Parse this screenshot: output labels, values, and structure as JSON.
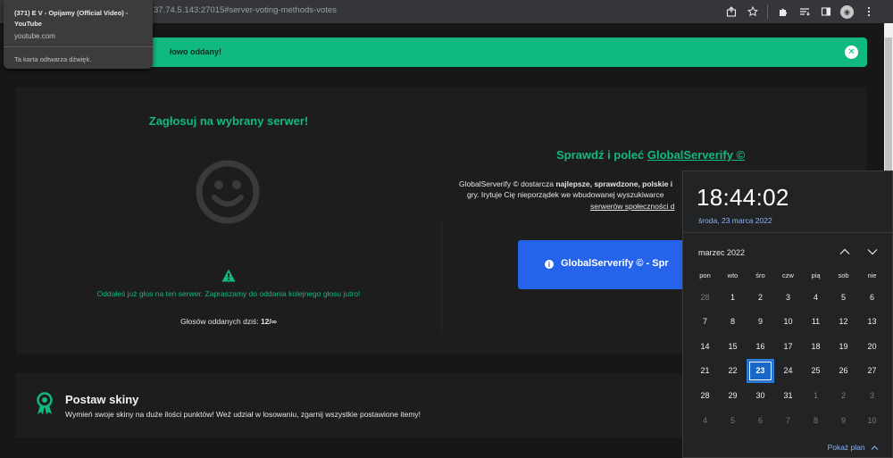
{
  "browser": {
    "url": "37.74.5.143:27015#server-voting-methods-votes"
  },
  "tab_tooltip": {
    "title": "(371) E V - Opijamy (Official Video) - YouTube",
    "domain": "youtube.com",
    "audio_note": "Ta karta odtwarza dźwięk."
  },
  "alert": {
    "text": "łowo oddany!",
    "close_icon": "close-icon"
  },
  "vote": {
    "title": "Zagłosuj na wybrany serwer!",
    "message": "Oddałeś już głos na ten serwer. Zapraszamy do oddania kolejnego głosu jutro!",
    "votes_label": "Głosów oddanych dziś:",
    "votes_value": "12/∞"
  },
  "globalserverify": {
    "title_prefix": "Sprawdź i poleć",
    "title_link": "GlobalServerify ©",
    "desc_line1_prefix": "GlobalServerify © dostarcza",
    "desc_line1_bold": "najlepsze, sprawdzone, polskie i",
    "desc_line2": "gry. Irytuje Cię nieporządek we wbudowanej wyszukiwarce",
    "desc_line3": "serwerów społeczności d",
    "button_label": "GlobalServerify © - Spr"
  },
  "skins": {
    "title": "Postaw skiny",
    "description": "Wymień swoje skiny na duże ilości punktów! Weź udział w losowaniu, zgarnij wszystkie postawione itemy!"
  },
  "calendar": {
    "time": "18:44:02",
    "date": "środa, 23 marca 2022",
    "month": "marzec 2022",
    "weekdays": [
      "pon",
      "wto",
      "śro",
      "czw",
      "pią",
      "sob",
      "nie"
    ],
    "weeks": [
      [
        "28",
        "1",
        "2",
        "3",
        "4",
        "5",
        "6"
      ],
      [
        "7",
        "8",
        "9",
        "10",
        "11",
        "12",
        "13"
      ],
      [
        "14",
        "15",
        "16",
        "17",
        "18",
        "19",
        "20"
      ],
      [
        "21",
        "22",
        "23",
        "24",
        "25",
        "26",
        "27"
      ],
      [
        "28",
        "29",
        "30",
        "31",
        "1",
        "2",
        "3"
      ],
      [
        "4",
        "5",
        "6",
        "7",
        "8",
        "9",
        "10"
      ]
    ],
    "today": "23",
    "show_plan": "Pokaż plan"
  },
  "colors": {
    "accent_green": "#10b981",
    "button_blue": "#2563eb",
    "calendar_today": "#1a67c7"
  }
}
